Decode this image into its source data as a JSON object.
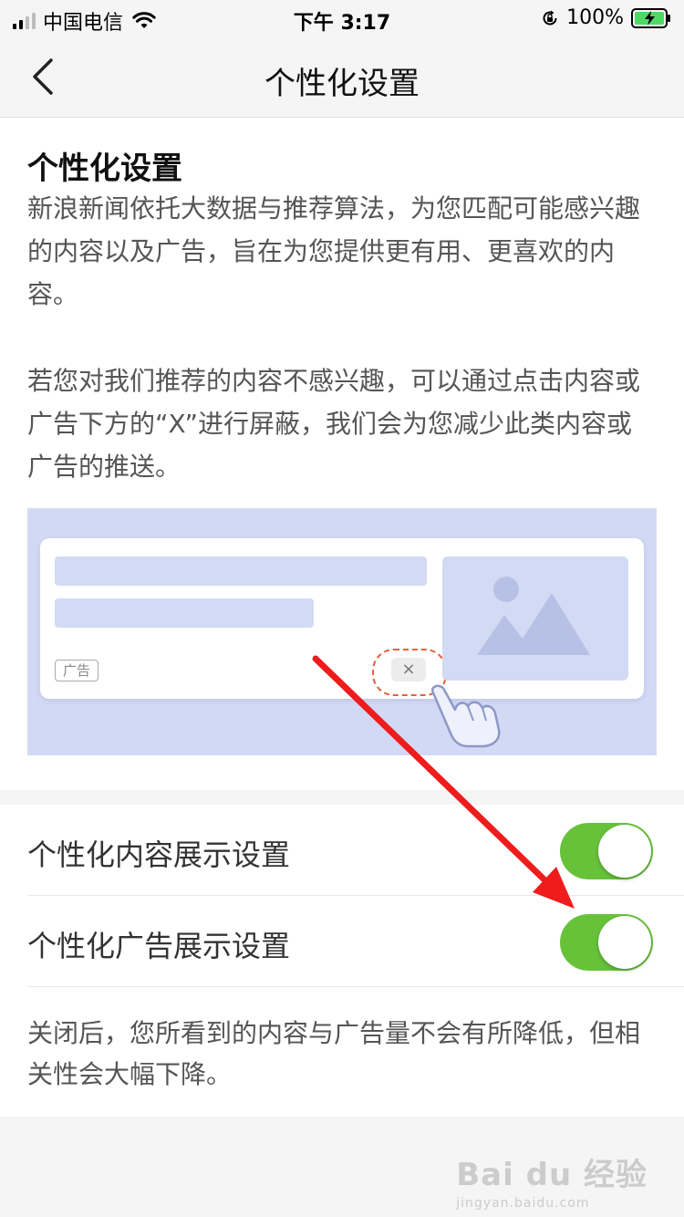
{
  "status_bar": {
    "carrier": "中国电信",
    "time": "下午 3:17",
    "battery": "100%"
  },
  "nav": {
    "title": "个性化设置"
  },
  "intro": {
    "title": "个性化设置",
    "paragraph1": "新浪新闻依托大数据与推荐算法，为您匹配可能感兴趣的内容以及广告，旨在为您提供更有用、更喜欢的内容。",
    "paragraph2": "若您对我们推荐的内容不感兴趣，可以通过点击内容或广告下方的“X”进行屏蔽，我们会为您减少此类内容或广告的推送。"
  },
  "illustration": {
    "ad_tag": "广告",
    "close_symbol": "×"
  },
  "settings": {
    "rows": [
      {
        "label": "个性化内容展示设置",
        "enabled": true
      },
      {
        "label": "个性化广告展示设置",
        "enabled": true
      }
    ],
    "note": "关闭后，您所看到的内容与广告量不会有所降低，但相关性会大幅下降。"
  },
  "colors": {
    "toggle_on": "#67c23a",
    "illustration_bg": "#d2d9f4",
    "annotation_arrow": "#ee1c1c"
  },
  "watermark": {
    "main": "Bai du 经验",
    "sub": "jingyan.baidu.com"
  }
}
